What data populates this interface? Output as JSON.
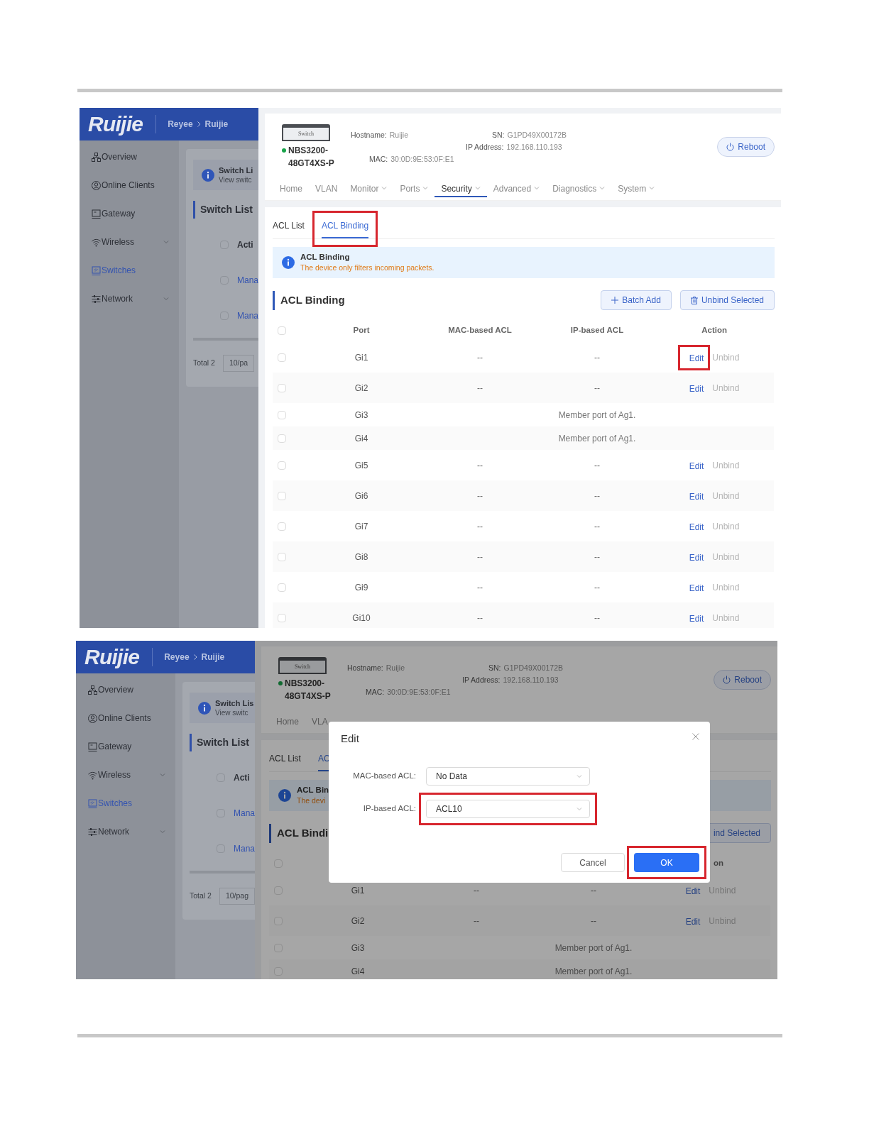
{
  "screens": [
    {
      "logo": "Ruijie",
      "breadcrumb": [
        "Reyee",
        "Ruijie"
      ],
      "sidebar": {
        "items": [
          {
            "label": "Overview",
            "selected": false,
            "expandable": false
          },
          {
            "label": "Online Clients",
            "selected": false,
            "expandable": false
          },
          {
            "label": "Gateway",
            "selected": false,
            "expandable": false
          },
          {
            "label": "Wireless",
            "selected": false,
            "expandable": true
          },
          {
            "label": "Switches",
            "selected": true,
            "expandable": false
          },
          {
            "label": "Network",
            "selected": false,
            "expandable": true
          }
        ]
      },
      "switch_list_panel": {
        "title": "Switch Li",
        "subtitle": "View switc",
        "heading": "Switch List",
        "rows": [
          {
            "kind": "header",
            "label": "Acti",
            "checked": false
          },
          {
            "kind": "link",
            "label": "Mana",
            "checked": false
          },
          {
            "kind": "link",
            "label": "Mana",
            "checked": false
          }
        ],
        "total": "Total 2",
        "page_size": "10/pa"
      },
      "device": {
        "image_label": "Switch",
        "online": true,
        "model": "NBS3200-48GT4XS-P",
        "hostname_label": "Hostname:",
        "hostname": "Ruijie",
        "sn_label": "SN:",
        "sn": "G1PD49X00172B",
        "ip_label": "IP Address:",
        "ip": "192.168.110.193",
        "mac_label": "MAC:",
        "mac": "30:0D:9E:53:0F:E1"
      },
      "reboot": "Reboot",
      "nav": [
        {
          "label": "Home",
          "dropdown": false,
          "selected": false
        },
        {
          "label": "VLAN",
          "dropdown": false,
          "selected": false
        },
        {
          "label": "Monitor",
          "dropdown": true,
          "selected": false
        },
        {
          "label": "Ports",
          "dropdown": true,
          "selected": false
        },
        {
          "label": "Security",
          "dropdown": true,
          "selected": true
        },
        {
          "label": "Advanced",
          "dropdown": true,
          "selected": false
        },
        {
          "label": "Diagnostics",
          "dropdown": true,
          "selected": false
        },
        {
          "label": "System",
          "dropdown": true,
          "selected": false
        }
      ],
      "tabs": [
        {
          "label": "ACL List",
          "selected": false,
          "highlighted": false
        },
        {
          "label": "ACL Binding",
          "selected": true,
          "highlighted": true
        }
      ],
      "alert": {
        "title": "ACL Binding",
        "text": "The device only filters incoming packets."
      },
      "section_title": "ACL Binding",
      "buttons": [
        {
          "kind": "batch_add",
          "label": "Batch Add",
          "icon": true
        },
        {
          "kind": "unbind",
          "label": "Unbind Selected",
          "icon": true
        }
      ],
      "table": {
        "all_checked": false,
        "columns": [
          {
            "kind": "port",
            "label": "Port"
          },
          {
            "kind": "mac",
            "label": "MAC-based ACL"
          },
          {
            "kind": "ip",
            "label": "IP-based ACL"
          },
          {
            "kind": "action",
            "label": "Action"
          }
        ],
        "rows": [
          {
            "kind": "acl",
            "checked": false,
            "port": "Gi1",
            "mac_acl": "--",
            "ip_acl": "--",
            "edit": "Edit",
            "unbind": "Unbind",
            "unbind_disabled": true,
            "highlighted": true
          },
          {
            "kind": "acl",
            "checked": false,
            "port": "Gi2",
            "mac_acl": "--",
            "ip_acl": "--",
            "edit": "Edit",
            "unbind": "Unbind",
            "unbind_disabled": true,
            "highlighted": false
          },
          {
            "kind": "member",
            "checked": false,
            "port": "Gi3",
            "note": "Member port of Ag1."
          },
          {
            "kind": "member",
            "checked": false,
            "port": "Gi4",
            "note": "Member port of Ag1."
          },
          {
            "kind": "acl",
            "checked": false,
            "port": "Gi5",
            "mac_acl": "--",
            "ip_acl": "--",
            "edit": "Edit",
            "unbind": "Unbind",
            "unbind_disabled": true,
            "highlighted": false
          },
          {
            "kind": "acl",
            "checked": false,
            "port": "Gi6",
            "mac_acl": "--",
            "ip_acl": "--",
            "edit": "Edit",
            "unbind": "Unbind",
            "unbind_disabled": true,
            "highlighted": false
          },
          {
            "kind": "acl",
            "checked": false,
            "port": "Gi7",
            "mac_acl": "--",
            "ip_acl": "--",
            "edit": "Edit",
            "unbind": "Unbind",
            "unbind_disabled": true,
            "highlighted": false
          },
          {
            "kind": "acl",
            "checked": false,
            "port": "Gi8",
            "mac_acl": "--",
            "ip_acl": "--",
            "edit": "Edit",
            "unbind": "Unbind",
            "unbind_disabled": true,
            "highlighted": false
          },
          {
            "kind": "acl",
            "checked": false,
            "port": "Gi9",
            "mac_acl": "--",
            "ip_acl": "--",
            "edit": "Edit",
            "unbind": "Unbind",
            "unbind_disabled": true,
            "highlighted": false
          },
          {
            "kind": "acl",
            "checked": false,
            "port": "Gi10",
            "mac_acl": "--",
            "ip_acl": "--",
            "edit": "Edit",
            "unbind": "Unbind",
            "unbind_disabled": true,
            "highlighted": false
          }
        ]
      }
    },
    {
      "logo": "Ruijie",
      "breadcrumb": [
        "Reyee",
        "Ruijie"
      ],
      "sidebar": {
        "items": [
          {
            "label": "Overview",
            "selected": false,
            "expandable": false
          },
          {
            "label": "Online Clients",
            "selected": false,
            "expandable": false
          },
          {
            "label": "Gateway",
            "selected": false,
            "expandable": false
          },
          {
            "label": "Wireless",
            "selected": false,
            "expandable": true
          },
          {
            "label": "Switches",
            "selected": true,
            "expandable": false
          },
          {
            "label": "Network",
            "selected": false,
            "expandable": true
          }
        ]
      },
      "switch_list_panel": {
        "title": "Switch Lis",
        "subtitle": "View switc",
        "heading": "Switch List",
        "rows": [
          {
            "kind": "header",
            "label": "Acti",
            "checked": false
          },
          {
            "kind": "link",
            "label": "Mana",
            "checked": false
          },
          {
            "kind": "link",
            "label": "Mana",
            "checked": false
          }
        ],
        "total": "Total 2",
        "page_size": "10/pag"
      },
      "device": {
        "image_label": "Switch",
        "online": true,
        "model": "NBS3200-48GT4XS-P",
        "hostname_label": "Hostname:",
        "hostname": "Ruijie",
        "sn_label": "SN:",
        "sn": "G1PD49X00172B",
        "ip_label": "IP Address:",
        "ip": "192.168.110.193",
        "mac_label": "MAC:",
        "mac": "30:0D:9E:53:0F:E1"
      },
      "reboot": "Reboot",
      "nav": [
        {
          "label": "Home",
          "dropdown": false,
          "selected": false
        },
        {
          "label": "VLA",
          "dropdown": false,
          "selected": false
        }
      ],
      "tabs": [
        {
          "label": "ACL List",
          "selected": false,
          "highlighted": false
        },
        {
          "label": "AC",
          "selected": true,
          "highlighted": false
        }
      ],
      "alert": {
        "title": "ACL Bin",
        "text": "The devi"
      },
      "section_title": "ACL Bindi",
      "buttons": [
        {
          "kind": "unbind",
          "label": "ind Selected",
          "icon": false
        }
      ],
      "table": {
        "all_checked": false,
        "columns": [
          {
            "kind": "action",
            "label": "on"
          }
        ],
        "rows": [
          {
            "kind": "acl",
            "checked": false,
            "port": "Gi1",
            "mac_acl": "--",
            "ip_acl": "--",
            "edit": "Edit",
            "unbind": "Unbind",
            "unbind_disabled": true,
            "highlighted": false
          },
          {
            "kind": "acl",
            "checked": false,
            "port": "Gi2",
            "mac_acl": "--",
            "ip_acl": "--",
            "edit": "Edit",
            "unbind": "Unbind",
            "unbind_disabled": true,
            "highlighted": false
          },
          {
            "kind": "member",
            "checked": false,
            "port": "Gi3",
            "note": "Member port of Ag1."
          },
          {
            "kind": "member",
            "checked": false,
            "port": "Gi4",
            "note": "Member port of Ag1."
          }
        ]
      },
      "modal": {
        "title": "Edit",
        "fields": [
          {
            "label": "MAC-based ACL:",
            "value": "No Data",
            "highlighted": false
          },
          {
            "label": "IP-based ACL:",
            "value": "ACL10",
            "highlighted": true
          }
        ],
        "buttons": [
          {
            "kind": "cancel",
            "label": "Cancel",
            "highlighted": false
          },
          {
            "kind": "ok",
            "label": "OK",
            "highlighted": true
          }
        ]
      }
    }
  ]
}
